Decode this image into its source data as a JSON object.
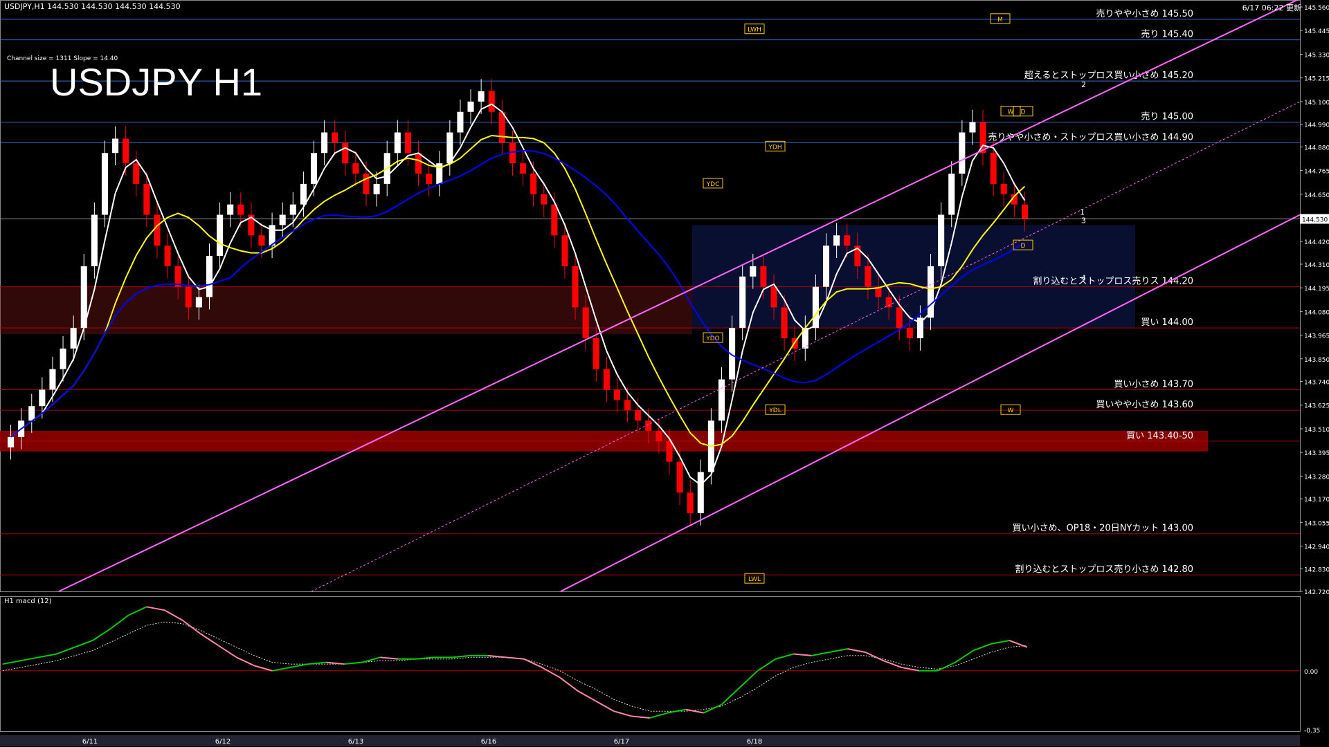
{
  "header": {
    "symbol_line": "USDJPY,H1  144.530 144.530 144.530 144.530",
    "timestamp": "6/17 06:22 更新"
  },
  "title": "USDJPY H1",
  "channel_info": "Channel size = 1311  Slope = 14.40",
  "macd_title": "H1  macd (12)",
  "colors": {
    "background": "#000000",
    "level_line_blue": "#3a6fd8",
    "level_line_red": "#b00000",
    "channel": "#ff66ff",
    "sma_fast": "#ffffff",
    "sma_mid": "#ffff00",
    "sma_slow": "#0000ff",
    "bull_candle": "#ffffff",
    "bear_candle": "#ff0000",
    "buy_zone": "#8b0000",
    "macd_up": "#00cc00",
    "macd_down": "#ff88aa"
  },
  "chart_data": [
    {
      "type": "candlestick",
      "title": "USDJPY H1",
      "symbol": "USDJPY",
      "timeframe": "H1",
      "ylim": [
        142.72,
        145.56
      ],
      "y_ticks": [
        "145.560",
        "145.445",
        "145.330",
        "145.215",
        "145.100",
        "144.990",
        "144.880",
        "144.765",
        "144.650",
        "144.530",
        "144.420",
        "144.310",
        "144.195",
        "144.080",
        "143.965",
        "143.850",
        "143.740",
        "143.625",
        "143.510",
        "143.395",
        "143.280",
        "143.170",
        "143.055",
        "142.940",
        "142.830",
        "142.720"
      ],
      "current_price": "144.530",
      "date_labels": [
        "6/11",
        "6/12",
        "6/13",
        "6/16",
        "6/17",
        "6/18"
      ],
      "levels": [
        {
          "label": "売りやや小さめ 145.50",
          "price": 145.5,
          "color": "blue"
        },
        {
          "label": "売り 145.40",
          "price": 145.4,
          "color": "blue"
        },
        {
          "label": "超えるとストップロス買い小さめ 145.20",
          "price": 145.2,
          "color": "blue"
        },
        {
          "label": "売り 145.00",
          "price": 145.0,
          "color": "blue"
        },
        {
          "label": "売りやや小さめ・ストップロス買い小さめ 144.90",
          "price": 144.9,
          "color": "blue"
        },
        {
          "label": "割り込むとストップロス売りス 144.20",
          "price": 144.2,
          "color": "red"
        },
        {
          "label": "買い 144.00",
          "price": 144.0,
          "color": "red"
        },
        {
          "label": "買い小さめ 143.70",
          "price": 143.7,
          "color": "red"
        },
        {
          "label": "買いやや小さめ 143.60",
          "price": 143.6,
          "color": "red"
        },
        {
          "label": "買い 143.40-50",
          "price": 143.45,
          "color": "red",
          "zone": [
            143.4,
            143.5
          ]
        },
        {
          "label": "買い小さめ、OP18・20日NYカット 143.00",
          "price": 143.0,
          "color": "red"
        },
        {
          "label": "割り込むとストップロス売り小さめ 142.80",
          "price": 142.8,
          "color": "red"
        }
      ],
      "tags": [
        "LWH",
        "M",
        "W",
        "D",
        "YDH",
        "YDC",
        "YDO",
        "YDL",
        "W",
        "D",
        "LWL"
      ],
      "wave_labels": [
        "1",
        "2",
        "3",
        "4"
      ],
      "close_series": [
        143.47,
        143.55,
        143.62,
        143.7,
        143.8,
        143.9,
        144.0,
        144.3,
        144.55,
        144.85,
        144.92,
        144.8,
        144.7,
        144.55,
        144.4,
        144.3,
        144.2,
        144.1,
        144.15,
        144.35,
        144.55,
        144.6,
        144.55,
        144.45,
        144.4,
        144.5,
        144.55,
        144.6,
        144.7,
        144.85,
        144.95,
        144.9,
        144.8,
        144.75,
        144.65,
        144.7,
        144.85,
        144.95,
        144.85,
        144.75,
        144.7,
        144.8,
        144.95,
        145.05,
        145.1,
        145.15,
        145.05,
        144.9,
        144.8,
        144.75,
        144.65,
        144.6,
        144.45,
        144.3,
        144.1,
        143.95,
        143.8,
        143.7,
        143.65,
        143.6,
        143.55,
        143.5,
        143.45,
        143.35,
        143.2,
        143.1,
        143.3,
        143.55,
        143.75,
        144.0,
        144.25,
        144.3,
        144.2,
        144.1,
        143.95,
        143.9,
        144.0,
        144.2,
        144.4,
        144.45,
        144.4,
        144.3,
        144.2,
        144.15,
        144.1,
        144.0,
        143.95,
        144.05,
        144.3,
        144.55,
        144.75,
        144.95,
        145.0,
        144.85,
        144.7,
        144.65,
        144.6,
        144.53
      ]
    },
    {
      "type": "line",
      "title": "H1 macd (12)",
      "ylim": [
        -0.35,
        0.41
      ],
      "y_ticks": [
        "0.00",
        "-0.35"
      ],
      "zero_line": 0.0,
      "series": [
        {
          "name": "macd",
          "values": [
            0.04,
            0.06,
            0.08,
            0.1,
            0.14,
            0.18,
            0.25,
            0.33,
            0.38,
            0.36,
            0.3,
            0.22,
            0.15,
            0.08,
            0.03,
            0.0,
            0.02,
            0.04,
            0.05,
            0.04,
            0.05,
            0.08,
            0.07,
            0.07,
            0.08,
            0.08,
            0.09,
            0.09,
            0.08,
            0.07,
            0.02,
            -0.04,
            -0.12,
            -0.18,
            -0.24,
            -0.27,
            -0.28,
            -0.25,
            -0.23,
            -0.25,
            -0.2,
            -0.1,
            0.0,
            0.07,
            0.1,
            0.09,
            0.11,
            0.13,
            0.11,
            0.06,
            0.02,
            0.0,
            0.0,
            0.05,
            0.12,
            0.16,
            0.18,
            0.14
          ]
        },
        {
          "name": "signal",
          "values": [
            0.0,
            0.02,
            0.04,
            0.06,
            0.09,
            0.12,
            0.17,
            0.22,
            0.27,
            0.29,
            0.28,
            0.24,
            0.19,
            0.14,
            0.09,
            0.05,
            0.04,
            0.04,
            0.04,
            0.04,
            0.05,
            0.06,
            0.06,
            0.07,
            0.07,
            0.07,
            0.08,
            0.08,
            0.08,
            0.07,
            0.04,
            0.0,
            -0.06,
            -0.11,
            -0.17,
            -0.21,
            -0.24,
            -0.24,
            -0.24,
            -0.23,
            -0.21,
            -0.16,
            -0.1,
            -0.03,
            0.02,
            0.05,
            0.07,
            0.09,
            0.09,
            0.07,
            0.04,
            0.02,
            0.01,
            0.03,
            0.07,
            0.11,
            0.14,
            0.15
          ]
        }
      ]
    }
  ]
}
